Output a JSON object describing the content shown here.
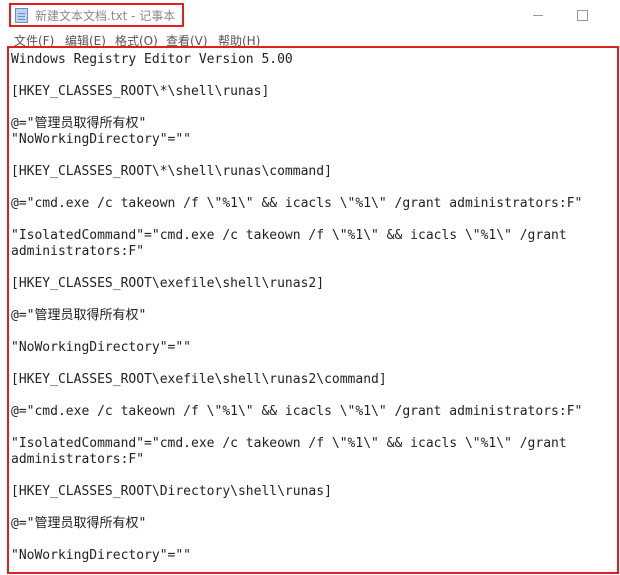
{
  "titlebar": {
    "title": "新建文本文档.txt - 记事本"
  },
  "menu": {
    "items": [
      "文件(F)",
      "编辑(E)",
      "格式(O)",
      "查看(V)",
      "帮助(H)"
    ]
  },
  "editor": {
    "lines": [
      "Windows Registry Editor Version 5.00",
      "",
      "[HKEY_CLASSES_ROOT\\*\\shell\\runas]",
      "",
      "@=\"管理员取得所有权\"",
      "\"NoWorkingDirectory\"=\"\"",
      "",
      "[HKEY_CLASSES_ROOT\\*\\shell\\runas\\command]",
      "",
      "@=\"cmd.exe /c takeown /f \\\"%1\\\" && icacls \\\"%1\\\" /grant administrators:F\"",
      "",
      "\"IsolatedCommand\"=\"cmd.exe /c takeown /f \\\"%1\\\" && icacls \\\"%1\\\" /grant",
      "administrators:F\"",
      "",
      "[HKEY_CLASSES_ROOT\\exefile\\shell\\runas2]",
      "",
      "@=\"管理员取得所有权\"",
      "",
      "\"NoWorkingDirectory\"=\"\"",
      "",
      "[HKEY_CLASSES_ROOT\\exefile\\shell\\runas2\\command]",
      "",
      "@=\"cmd.exe /c takeown /f \\\"%1\\\" && icacls \\\"%1\\\" /grant administrators:F\"",
      "",
      "\"IsolatedCommand\"=\"cmd.exe /c takeown /f \\\"%1\\\" && icacls \\\"%1\\\" /grant",
      "administrators:F\"",
      "",
      "[HKEY_CLASSES_ROOT\\Directory\\shell\\runas]",
      "",
      "@=\"管理员取得所有权\"",
      "",
      "\"NoWorkingDirectory\"=\"\""
    ]
  }
}
